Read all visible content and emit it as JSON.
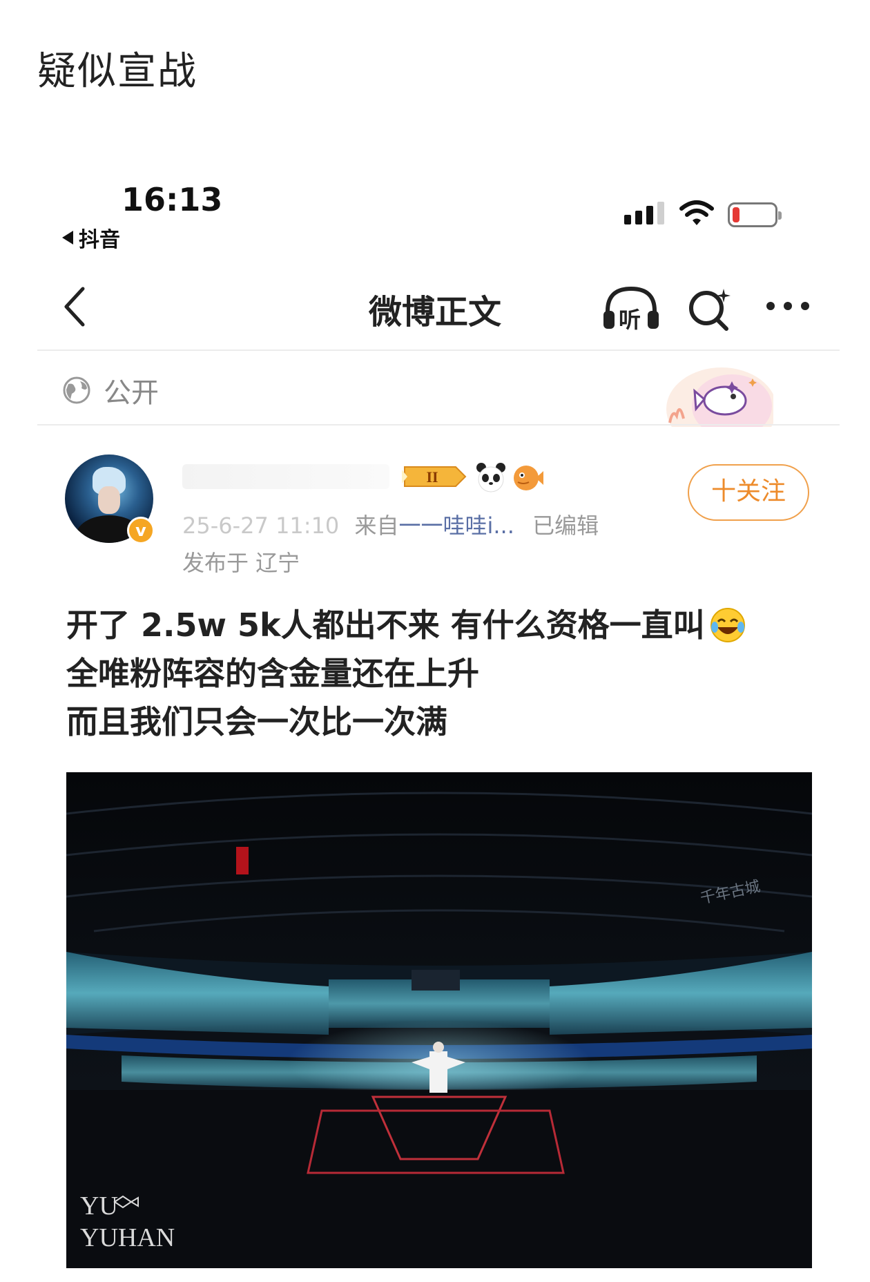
{
  "post_caption": "疑似宣战",
  "status_bar": {
    "time": "16:13",
    "back_app_label": "抖音"
  },
  "nav": {
    "title": "微博正文",
    "listen_label": "听"
  },
  "visibility": {
    "label": "公开"
  },
  "post": {
    "verified_badge": "v",
    "level_badge": "II",
    "meta": {
      "date": "25-6-27 11:10",
      "source_prefix": "来自",
      "source": "一一哇哇i...",
      "edited": "已编辑",
      "location": "发布于 辽宁"
    },
    "follow_label": "十关注",
    "text_lines": [
      "开了 2.5w 5k人都出不来 有什么资格一直叫",
      "全唯粉阵容的含金量还在上升",
      "而且我们只会一次比一次满"
    ],
    "photo": {
      "watermark_line1": "YU",
      "watermark_line2": "YUHAN",
      "venue_text": "千年古城"
    }
  },
  "colors": {
    "accent_orange": "#ed8b2b",
    "source_link": "#5a6fa5",
    "battery_low": "#e53935"
  },
  "icons": [
    "signal-icon",
    "wifi-icon",
    "battery-icon",
    "back-chevron-icon",
    "listen-icon",
    "search-icon",
    "more-icon",
    "globe-icon",
    "panda-icon",
    "fish-icon",
    "laughing-crying-emoji"
  ]
}
